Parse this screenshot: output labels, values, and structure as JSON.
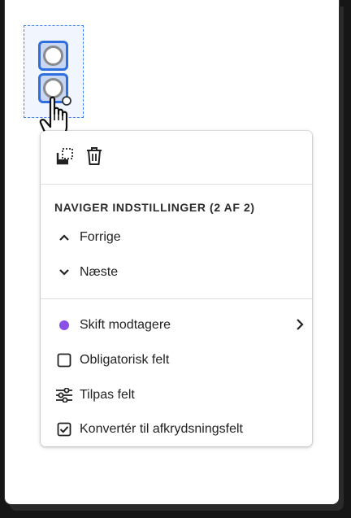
{
  "menu": {
    "toolbar": {
      "icons": [
        "duplicate-icon",
        "trash-icon"
      ]
    },
    "section_title": "NAVIGER INDSTILLINGER (2 AF 2)",
    "items": [
      {
        "label": "Forrige",
        "icon": "chevron-up-icon"
      },
      {
        "label": "Næste",
        "icon": "chevron-down-icon"
      },
      {
        "label": "Skift modtagere",
        "icon": "recipient-dot-icon",
        "submenu": true,
        "dot_color": "#8a50e8"
      },
      {
        "label": "Obligatorisk felt",
        "icon": "checkbox-empty-icon"
      },
      {
        "label": "Tilpas felt",
        "icon": "sliders-icon"
      },
      {
        "label": "Konvertér til afkrydsningsfelt",
        "icon": "checkbox-checked-icon"
      }
    ]
  },
  "colors": {
    "selection_border": "#3b82f6",
    "radio_border": "#2f6ee0",
    "recipient_dot": "#8a50e8"
  }
}
